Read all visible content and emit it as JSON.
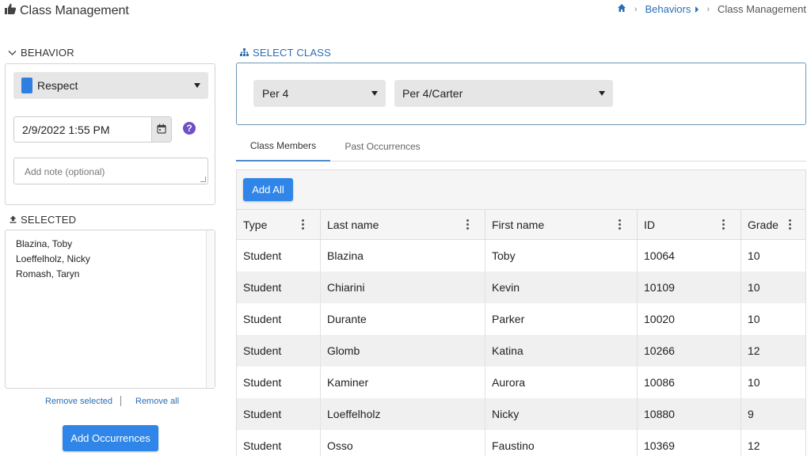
{
  "page": {
    "title": "Class Management"
  },
  "breadcrumb": {
    "items": [
      "Behaviors",
      "Class Management"
    ]
  },
  "behavior": {
    "section_label": "BEHAVIOR",
    "selected_behavior": "Respect",
    "behavior_color": "#2f7fe0",
    "datetime_value": "2/9/2022 1:55 PM",
    "help_glyph": "?",
    "note_placeholder": "Add note (optional)"
  },
  "selected": {
    "section_label": "SELECTED",
    "students": [
      "Blazina, Toby",
      "Loeffelholz, Nicky",
      "Romash, Taryn"
    ],
    "remove_selected_label": "Remove selected",
    "remove_all_label": "Remove all",
    "add_occurrences_label": "Add Occurrences"
  },
  "select_class": {
    "section_label": "SELECT CLASS",
    "period_value": "Per 4",
    "class_value": "Per 4/Carter"
  },
  "tabs": [
    {
      "label": "Class Members",
      "active": true
    },
    {
      "label": "Past Occurrences",
      "active": false
    }
  ],
  "grid": {
    "add_all_label": "Add All",
    "columns": [
      "Type",
      "Last name",
      "First name",
      "ID",
      "Grade"
    ],
    "rows": [
      [
        "Student",
        "Blazina",
        "Toby",
        "10064",
        "10"
      ],
      [
        "Student",
        "Chiarini",
        "Kevin",
        "10109",
        "10"
      ],
      [
        "Student",
        "Durante",
        "Parker",
        "10020",
        "10"
      ],
      [
        "Student",
        "Glomb",
        "Katina",
        "10266",
        "12"
      ],
      [
        "Student",
        "Kaminer",
        "Aurora",
        "10086",
        "10"
      ],
      [
        "Student",
        "Loeffelholz",
        "Nicky",
        "10880",
        "9"
      ],
      [
        "Student",
        "Osso",
        "Faustino",
        "10369",
        "12"
      ]
    ]
  },
  "colors": {
    "accent": "#2f86e8",
    "link": "#2a6fb5",
    "help": "#6f4fc2"
  },
  "icons": {
    "title": "thumbs-up-icon",
    "home": "home-icon",
    "behavior_toggle": "chevron-down-icon",
    "selected": "upload-icon",
    "select_class": "sitemap-icon",
    "calendar": "calendar-icon",
    "column_menu": "vertical-dots-icon"
  }
}
